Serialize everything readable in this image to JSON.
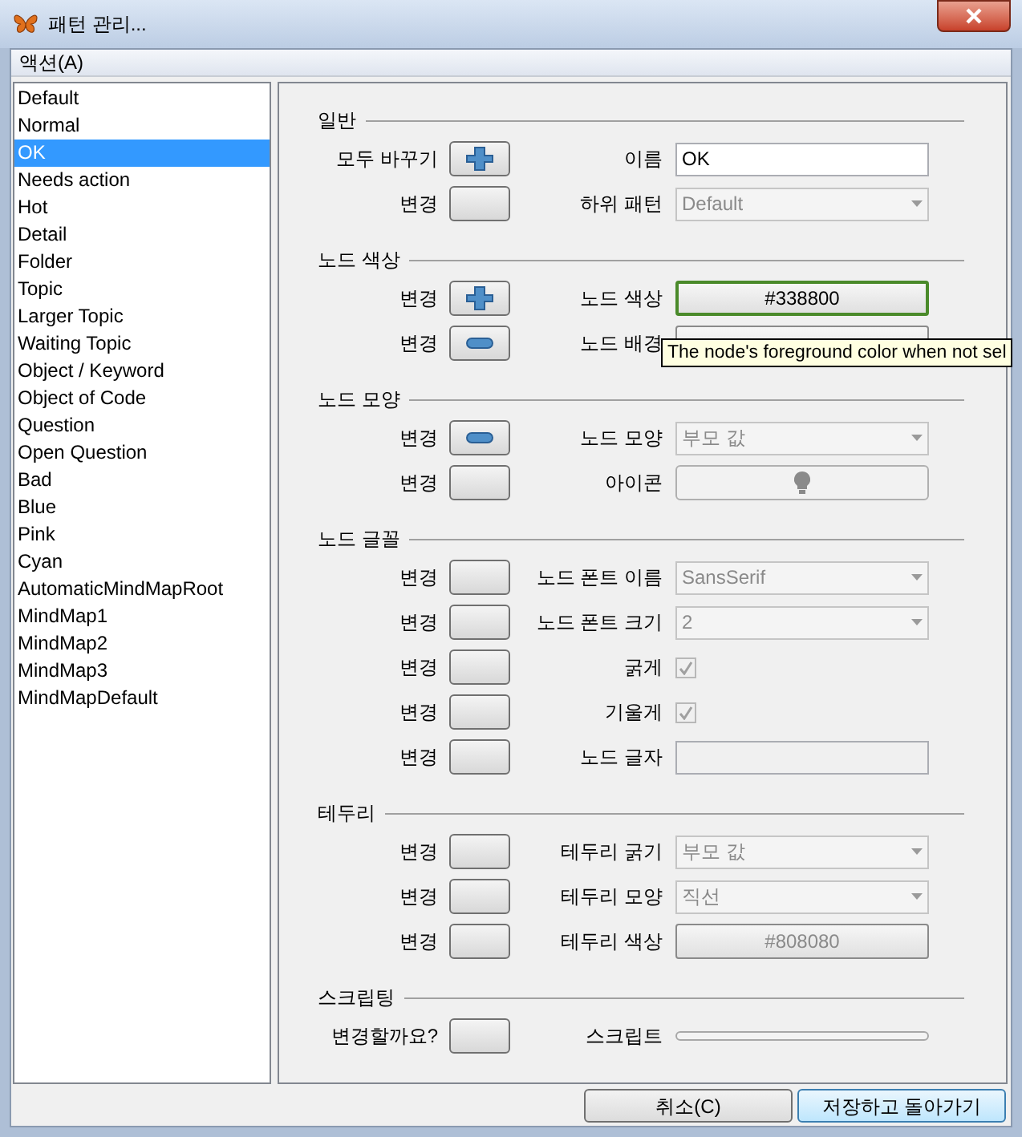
{
  "window": {
    "title": "패턴 관리..."
  },
  "menu": [
    {
      "label": "액션(A)"
    }
  ],
  "patterns": [
    {
      "label": "Default",
      "selected": false
    },
    {
      "label": "Normal",
      "selected": false
    },
    {
      "label": "OK",
      "selected": true
    },
    {
      "label": "Needs action",
      "selected": false
    },
    {
      "label": "Hot",
      "selected": false
    },
    {
      "label": "Detail",
      "selected": false
    },
    {
      "label": "Folder",
      "selected": false
    },
    {
      "label": "Topic",
      "selected": false
    },
    {
      "label": "Larger Topic",
      "selected": false
    },
    {
      "label": "Waiting Topic",
      "selected": false
    },
    {
      "label": "Object / Keyword",
      "selected": false
    },
    {
      "label": "Object of Code",
      "selected": false
    },
    {
      "label": "Question",
      "selected": false
    },
    {
      "label": "Open Question",
      "selected": false
    },
    {
      "label": "Bad",
      "selected": false
    },
    {
      "label": "Blue",
      "selected": false
    },
    {
      "label": "Pink",
      "selected": false
    },
    {
      "label": "Cyan",
      "selected": false
    },
    {
      "label": "AutomaticMindMapRoot",
      "selected": false
    },
    {
      "label": "MindMap1",
      "selected": false
    },
    {
      "label": "MindMap2",
      "selected": false
    },
    {
      "label": "MindMap3",
      "selected": false
    },
    {
      "label": "MindMapDefault",
      "selected": false
    }
  ],
  "sections": [
    {
      "title": "일반",
      "rows": [
        {
          "change_label": "모두 바꾸기",
          "kind": "plus",
          "label": "이름",
          "field": {
            "kind": "text",
            "value": "OK"
          }
        },
        {
          "change_label": "변경",
          "kind": "unset",
          "label": "하위 패턴",
          "field": {
            "kind": "combo",
            "value": "Default",
            "disabled": true
          }
        }
      ]
    },
    {
      "title": "노드 색상",
      "rows": [
        {
          "change_label": "변경",
          "kind": "plus",
          "label": "노드 색상",
          "field": {
            "kind": "color",
            "value": "#338800",
            "focused": true
          }
        },
        {
          "change_label": "변경",
          "kind": "minus",
          "label": "노드 배경",
          "field": {
            "kind": "color"
          }
        }
      ]
    },
    {
      "title": "노드 모양",
      "rows": [
        {
          "change_label": "변경",
          "kind": "minus",
          "label": "노드 모양",
          "field": {
            "kind": "combo",
            "value": "부모 값",
            "disabled": true
          }
        },
        {
          "change_label": "변경",
          "kind": "unset",
          "label": "아이콘",
          "field": {
            "kind": "icon"
          }
        }
      ]
    },
    {
      "title": "노드 글꼴",
      "rows": [
        {
          "change_label": "변경",
          "kind": "unset",
          "label": "노드 폰트 이름",
          "field": {
            "kind": "combo",
            "value": "SansSerif",
            "disabled": true
          }
        },
        {
          "change_label": "변경",
          "kind": "unset",
          "label": "노드 폰트 크기",
          "field": {
            "kind": "combo",
            "value": "2",
            "disabled": true
          }
        },
        {
          "change_label": "변경",
          "kind": "unset",
          "label": "굵게",
          "field": {
            "kind": "checkbox",
            "checked": true,
            "disabled": true
          }
        },
        {
          "change_label": "변경",
          "kind": "unset",
          "label": "기울게",
          "field": {
            "kind": "checkbox",
            "checked": true,
            "disabled": true
          }
        },
        {
          "change_label": "변경",
          "kind": "unset",
          "label": "노드 글자",
          "field": {
            "kind": "text",
            "disabled": true
          }
        }
      ]
    },
    {
      "title": "테두리",
      "rows": [
        {
          "change_label": "변경",
          "kind": "unset",
          "label": "테두리 굵기",
          "field": {
            "kind": "combo",
            "value": "부모 값",
            "disabled": true
          }
        },
        {
          "change_label": "변경",
          "kind": "unset",
          "label": "테두리 모양",
          "field": {
            "kind": "combo",
            "value": "직선",
            "disabled": true
          }
        },
        {
          "change_label": "변경",
          "kind": "unset",
          "label": "테두리 색상",
          "field": {
            "kind": "color",
            "value": "#808080",
            "disabled": true
          }
        }
      ]
    },
    {
      "title": "스크립팅",
      "rows": [
        {
          "change_label": "변경할까요?",
          "kind": "unset",
          "label": "스크립트",
          "field": {
            "kind": "script"
          }
        }
      ]
    }
  ],
  "tooltip": {
    "text": "The node's foreground color when not sel"
  },
  "buttons": [
    {
      "label": "취소(C)",
      "default": false
    },
    {
      "label": "저장하고 돌아가기",
      "default": true
    }
  ]
}
